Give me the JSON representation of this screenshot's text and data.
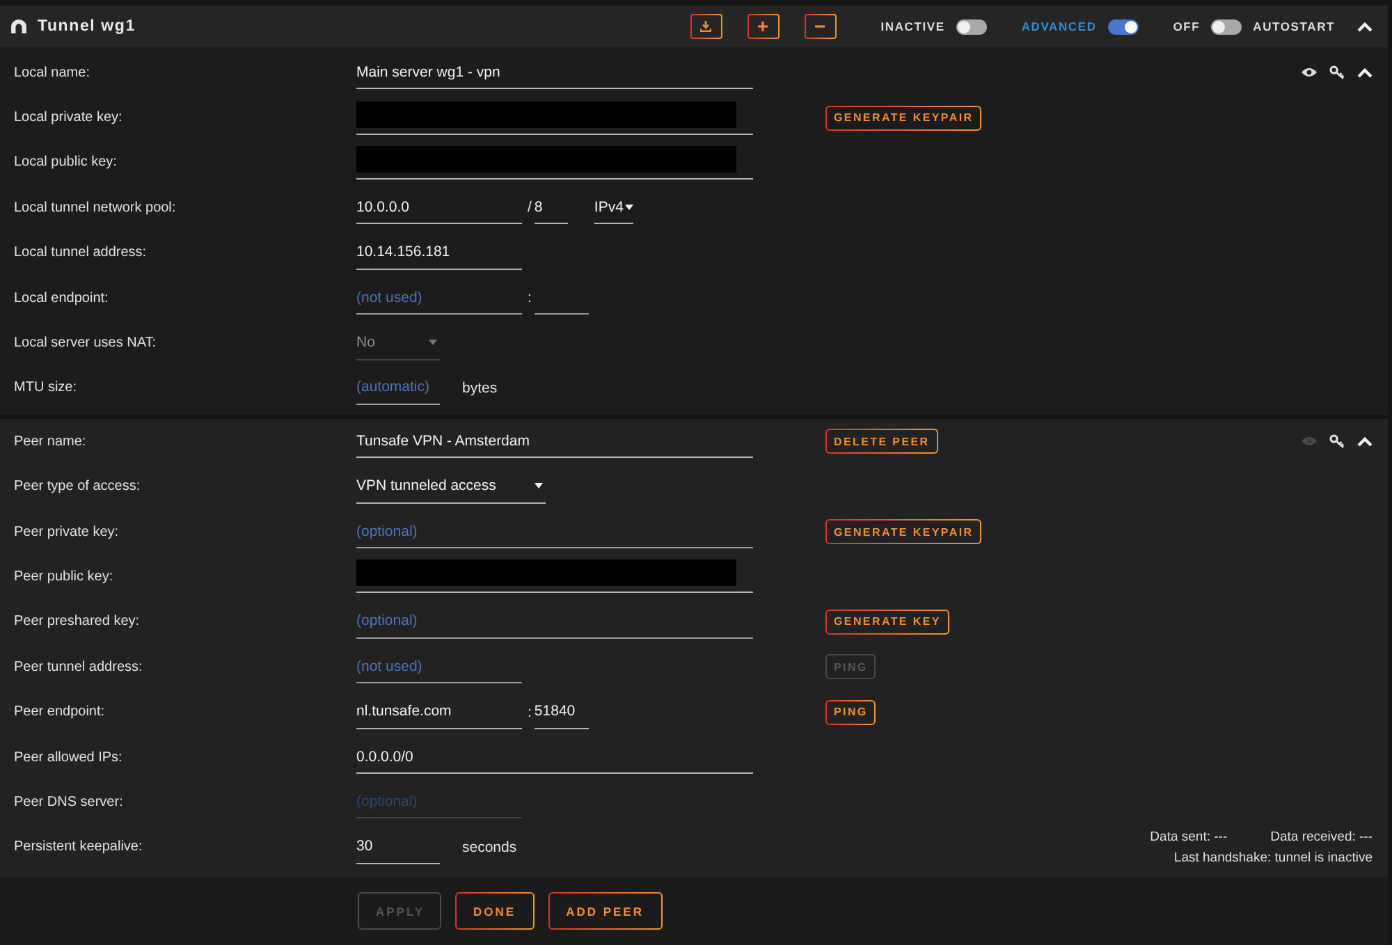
{
  "header": {
    "title": "Tunnel wg1",
    "toggles": [
      {
        "label": "INACTIVE",
        "on": false
      },
      {
        "label": "ADVANCED",
        "on": true
      },
      {
        "label": "OFF",
        "label_after": "AUTOSTART",
        "on": false
      }
    ]
  },
  "local": {
    "reveal_keys": true,
    "rows": [
      {
        "label": "Local name:",
        "kind": "text",
        "field": {
          "value": "Main server wg1 - vpn",
          "disabled": false,
          "redacted": false
        }
      },
      {
        "label": "Local private key:",
        "kind": "text",
        "field": {
          "disabled": false,
          "redacted": true
        },
        "button": {
          "label": "GENERATE KEYPAIR",
          "disabled": false
        }
      },
      {
        "label": "Local public key:",
        "kind": "text",
        "field": {
          "disabled": false,
          "redacted": true
        }
      },
      {
        "label": "Local tunnel network pool:",
        "kind": "pool",
        "field": {
          "value": "10.0.0.0",
          "disabled": false
        },
        "separator": "/",
        "prefix": {
          "value": "8"
        },
        "select": {
          "value": "IPv4"
        }
      },
      {
        "label": "Local tunnel address:",
        "kind": "address",
        "field": {
          "value": "10.14.156.181",
          "disabled": false
        }
      },
      {
        "label": "Local endpoint:",
        "kind": "endpoint",
        "field": {
          "placeholder": "(not used)",
          "disabled": false
        },
        "separator": ":"
      },
      {
        "label": "Local server uses NAT:",
        "kind": "select",
        "field": {
          "value": "No",
          "disabled": true
        }
      },
      {
        "label": "MTU size:",
        "kind": "unit",
        "field": {
          "placeholder": "(automatic)",
          "disabled": false
        },
        "unit": "bytes"
      }
    ]
  },
  "peer": {
    "reveal_keys": false,
    "rows": [
      {
        "label": "Peer name:",
        "kind": "text",
        "field": {
          "value": "Tunsafe VPN - Amsterdam",
          "disabled": false,
          "redacted": false
        },
        "button": {
          "label": "DELETE PEER",
          "disabled": false
        }
      },
      {
        "label": "Peer type of access:",
        "kind": "select",
        "field": {
          "value": "VPN tunneled access",
          "disabled": false
        }
      },
      {
        "label": "Peer private key:",
        "kind": "text",
        "field": {
          "placeholder": "(optional)",
          "disabled": false,
          "redacted": false
        },
        "button": {
          "label": "GENERATE KEYPAIR",
          "disabled": false
        }
      },
      {
        "label": "Peer public key:",
        "kind": "text",
        "field": {
          "disabled": false,
          "redacted": true
        }
      },
      {
        "label": "Peer preshared key:",
        "kind": "text",
        "field": {
          "placeholder": "(optional)",
          "disabled": false,
          "redacted": false
        },
        "button": {
          "label": "GENERATE KEY",
          "disabled": false
        }
      },
      {
        "label": "Peer tunnel address:",
        "kind": "address",
        "field": {
          "placeholder": "(not used)",
          "disabled": false
        },
        "button": {
          "label": "PING",
          "disabled": true
        }
      },
      {
        "label": "Peer endpoint:",
        "kind": "endpoint",
        "field": {
          "value": "nl.tunsafe.com",
          "disabled": false
        },
        "separator": ":",
        "port": {
          "value": "51840"
        },
        "button": {
          "label": "PING",
          "disabled": false
        }
      },
      {
        "label": "Peer allowed IPs:",
        "kind": "text",
        "field": {
          "value": "0.0.0.0/0",
          "disabled": false,
          "redacted": false
        }
      },
      {
        "label": "Peer DNS server:",
        "kind": "address",
        "field": {
          "placeholder": "(optional)",
          "disabled": true
        }
      },
      {
        "label": "Persistent keepalive:",
        "kind": "unit",
        "field": {
          "value": "30",
          "disabled": false
        },
        "unit": "seconds"
      }
    ],
    "stats": {
      "data_sent": "Data sent: ---",
      "data_received": "Data received: ---",
      "last_handshake": "Last handshake: tunnel is inactive"
    }
  },
  "footer": {
    "buttons": [
      {
        "label": "APPLY",
        "disabled": true
      },
      {
        "label": "DONE",
        "disabled": false
      },
      {
        "label": "ADD PEER",
        "disabled": false
      }
    ]
  }
}
